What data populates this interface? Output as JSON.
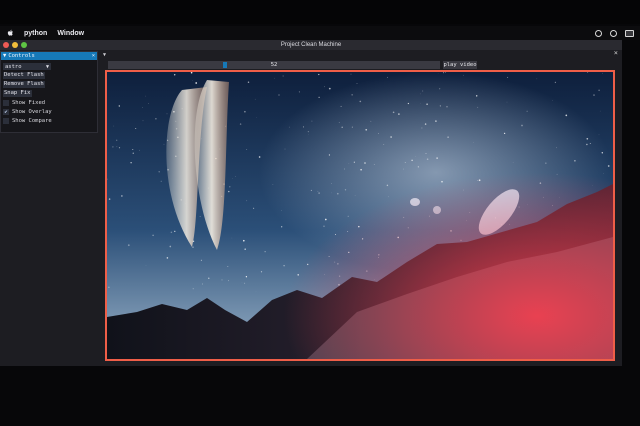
{
  "menubar": {
    "apple_icon": "apple-icon",
    "items": [
      "python",
      "Window"
    ]
  },
  "window": {
    "title": "Project Clean Machine",
    "close_glyph": "×"
  },
  "controls": {
    "header": "Controls",
    "header_arrow": "▼",
    "close_glyph": "×",
    "preset": {
      "value": "astro",
      "caret": "▼"
    },
    "buttons": [
      "Detect Flash",
      "Remove Flash",
      "Snap Fix"
    ],
    "checkboxes": [
      {
        "label": "Show Fixed",
        "checked": false
      },
      {
        "label": "Show Overlay",
        "checked": true
      },
      {
        "label": "Show Compare",
        "checked": false
      }
    ],
    "check_glyph": "✔"
  },
  "frame_control": {
    "dock_arrow": "▼",
    "frame_value": "52",
    "slider_position_fraction": 0.35,
    "play_label": "play video"
  },
  "colors": {
    "accent": "#1679b8",
    "overlay_border": "#ef5e48"
  }
}
